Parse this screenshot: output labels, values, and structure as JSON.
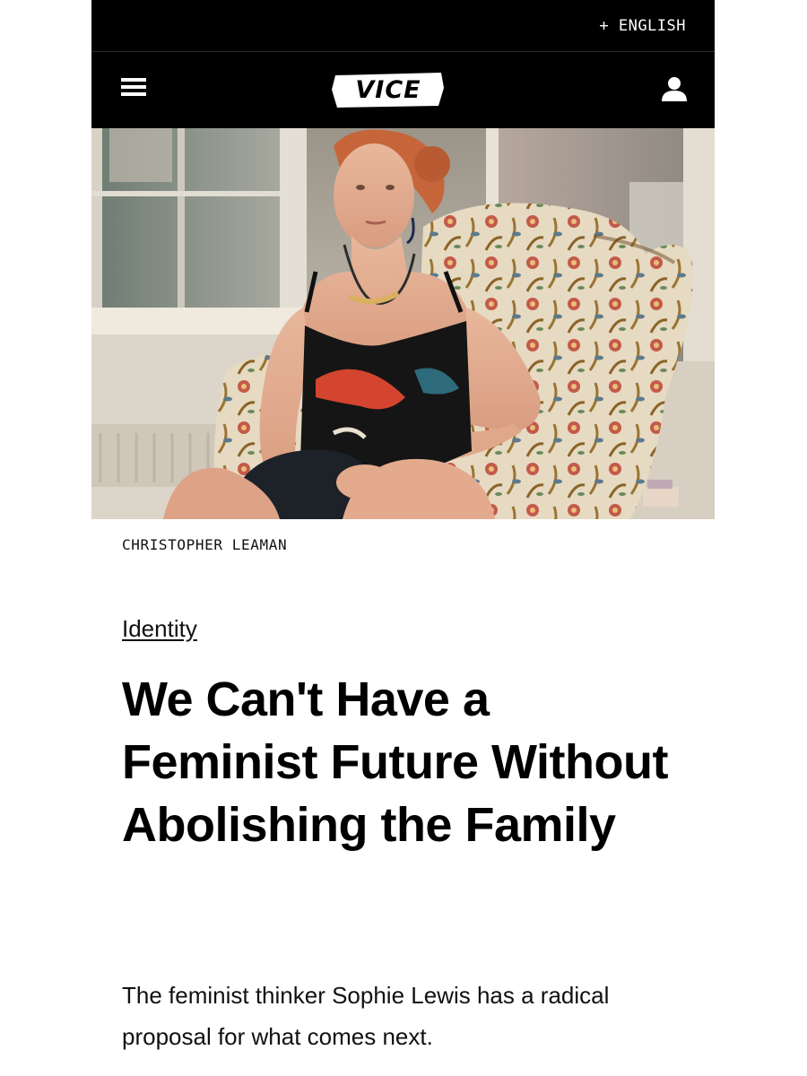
{
  "header": {
    "language_label": "+ ENGLISH",
    "logo_text": "VICE"
  },
  "photo": {
    "credit": "CHRISTOPHER LEAMAN"
  },
  "article": {
    "category": "Identity",
    "title": "We Can't Have a Feminist Future Without Abolishing the Family",
    "dek": "The feminist thinker Sophie Lewis has a radical proposal for what comes next."
  },
  "colors": {
    "header_bg": "#000000",
    "text": "#111111",
    "page_bg": "#ffffff"
  }
}
